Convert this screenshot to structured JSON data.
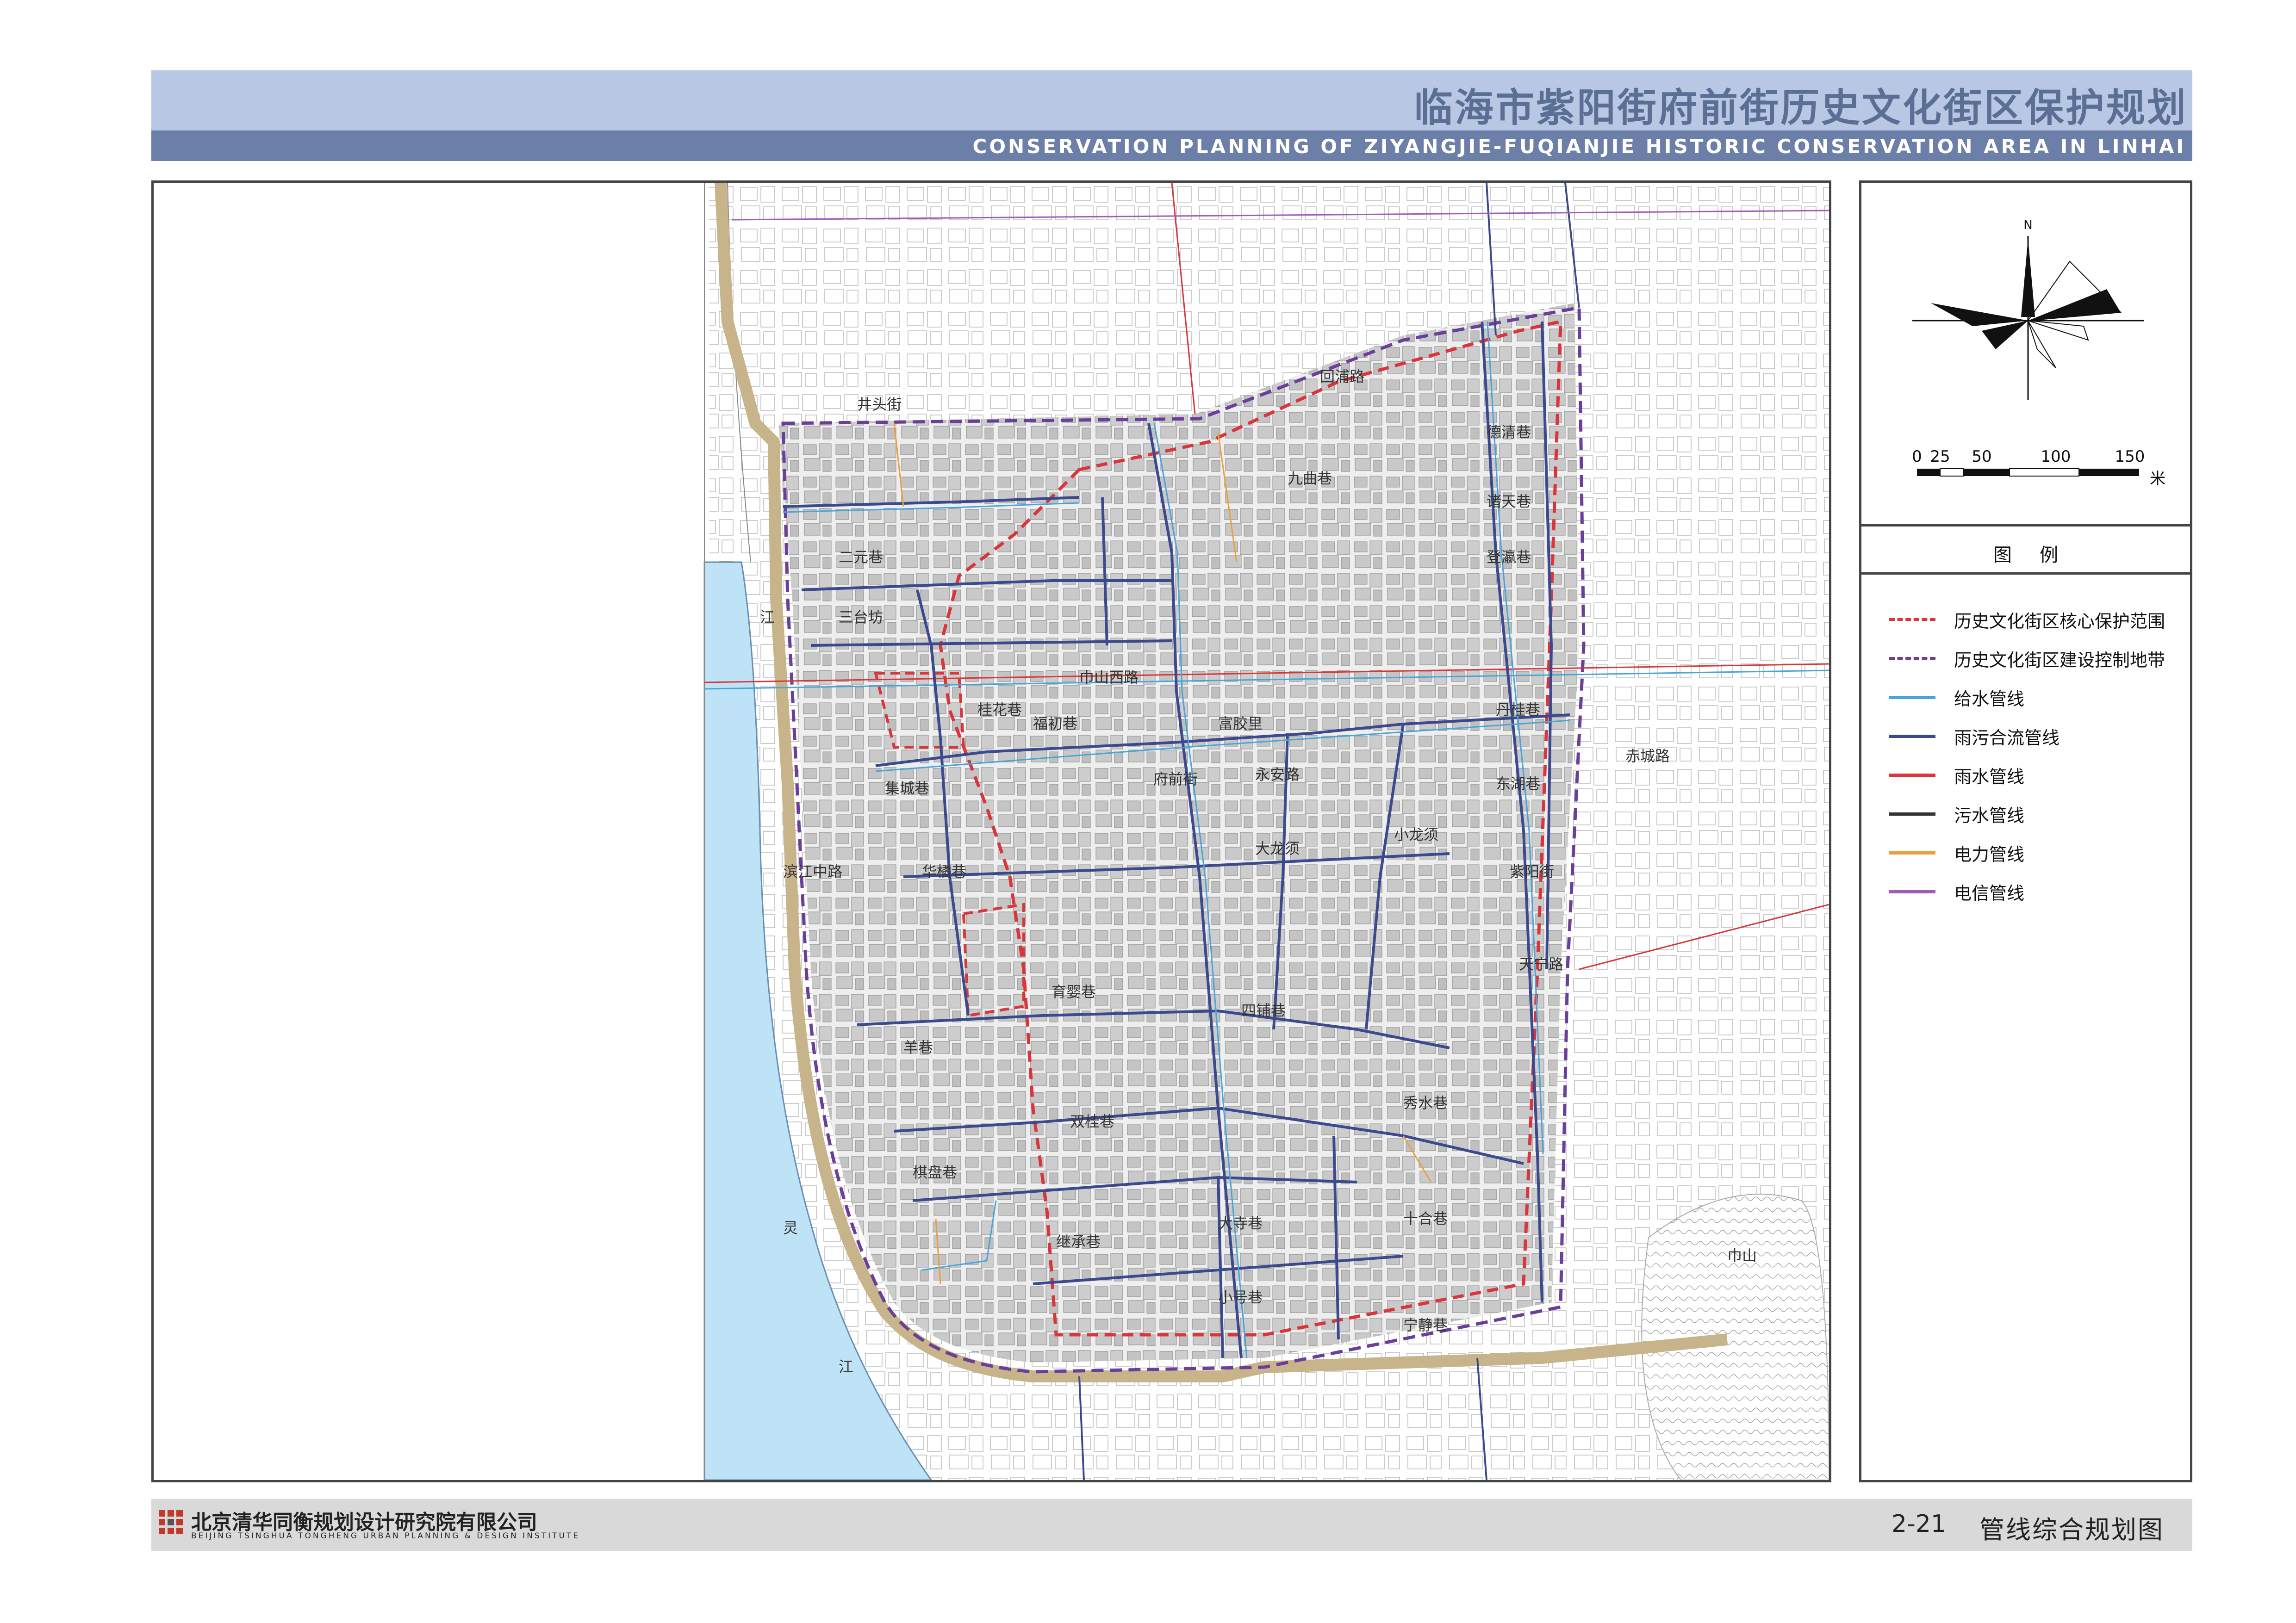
{
  "header": {
    "title_cn": "临海市紫阳街府前街历史文化街区保护规划",
    "title_en": "CONSERVATION PLANNING OF ZIYANGJIE-FUQIANJIE  HISTORIC CONSERVATION AREA IN LINHAI"
  },
  "compass": {
    "north_label": "N"
  },
  "scale_bar": {
    "labels": [
      "0",
      "25",
      "50",
      "100",
      "150"
    ],
    "unit": "米"
  },
  "legend": {
    "title": "图例",
    "items": [
      {
        "label": "历史文化街区核心保护范围",
        "color": "#d8363b",
        "style": "dashed"
      },
      {
        "label": "历史文化街区建设控制地带",
        "color": "#6a3e9a",
        "style": "dashed"
      },
      {
        "label": "给水管线",
        "color": "#4aa4d8",
        "style": "solid"
      },
      {
        "label": "雨污合流管线",
        "color": "#3b4a8e",
        "style": "solid"
      },
      {
        "label": "雨水管线",
        "color": "#d8363b",
        "style": "solid"
      },
      {
        "label": "污水管线",
        "color": "#333333",
        "style": "solid"
      },
      {
        "label": "电力管线",
        "color": "#e8a040",
        "style": "solid"
      },
      {
        "label": "电信管线",
        "color": "#a15cb8",
        "style": "solid"
      }
    ]
  },
  "map": {
    "labels": {
      "jingtou_jie": "井头街",
      "hongqiao_lu": "回浦路",
      "jiuda_xiang": "九曲巷",
      "yuanyuan_xiang": "二元巷",
      "tai_xiang": "三台坊",
      "jiang": "江",
      "shiwu_lu": "巾山西路",
      "guihua_xiang": "桂花巷",
      "fuchu_xiang": "福初巷",
      "fuqian_jie": "府前街",
      "yongan_lu": "永安路",
      "jicheng_xiang": "集城巷",
      "huayan_xiang": "华橘巷",
      "dalong_xu": "大龙须",
      "xiaolong_xu": "小龙须",
      "ziyang_jie": "紫阳街",
      "binjiang_lu": "滨江中路",
      "chigong_lu": "赤城路",
      "hexiang": "羊巷",
      "shuanggui_xiang": "双桂巷",
      "qipan_xiang": "棋盘巷",
      "ling": "灵",
      "jiang2": "江",
      "jinshan": "巾山",
      "dingshan_lu": "丹桂巷",
      "tianning_lu": "天宁路",
      "shiheng_xiang": "十合巷",
      "dasizi_xiang": "大寺巷",
      "xiaosizi_xiang": "小号巷",
      "sijiao_xiang": "四铺巷",
      "dongjiao_xiang": "东湖巷",
      "dengying_xiang": "登瀛巷",
      "zhutian_xiang": "诸天巷",
      "dengxiang": "德清巷",
      "liuhe_xiang": "秀水巷",
      "yingzi_xiang": "育婴巷",
      "sheng_xiang": "继承巷",
      "fuyu_xiang": "富胶里",
      "shuishou": "宁静巷"
    }
  },
  "footer": {
    "org_cn": "北京清华同衡规划设计研究院有限公司",
    "org_en": "BEIJING TSINGHUA TONGHENG URBAN PLANNING & DESIGN INSTITUTE",
    "drawing_no": "2-21",
    "drawing_title": "管线综合规划图"
  }
}
